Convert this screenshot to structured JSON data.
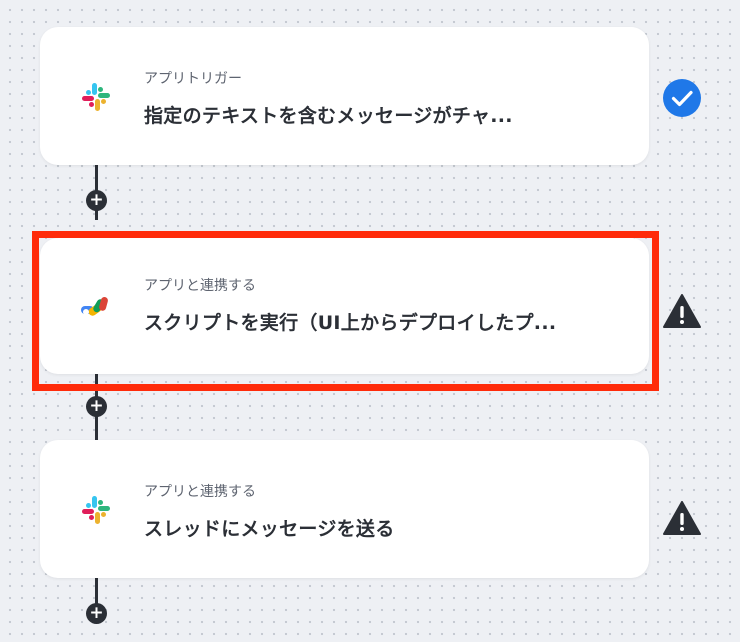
{
  "flow": {
    "steps": [
      {
        "kind": "アプリトリガー",
        "title": "指定のテキストを含むメッセージがチャ...",
        "app_icon": "slack-icon",
        "status_icon": "checkmark-icon",
        "status_color": "#1f78e8"
      },
      {
        "kind": "アプリと連携する",
        "title": "スクリプトを実行（UI上からデプロイしたプ...",
        "app_icon": "google-apps-script-icon",
        "status_icon": "warning-icon",
        "status_color": "#2b2f36",
        "highlighted": true,
        "highlight_color": "#ff2b0a"
      },
      {
        "kind": "アプリと連携する",
        "title": "スレッドにメッセージを送る",
        "app_icon": "slack-icon",
        "status_icon": "warning-icon",
        "status_color": "#2b2f36"
      }
    ],
    "add_step_label": "+"
  }
}
